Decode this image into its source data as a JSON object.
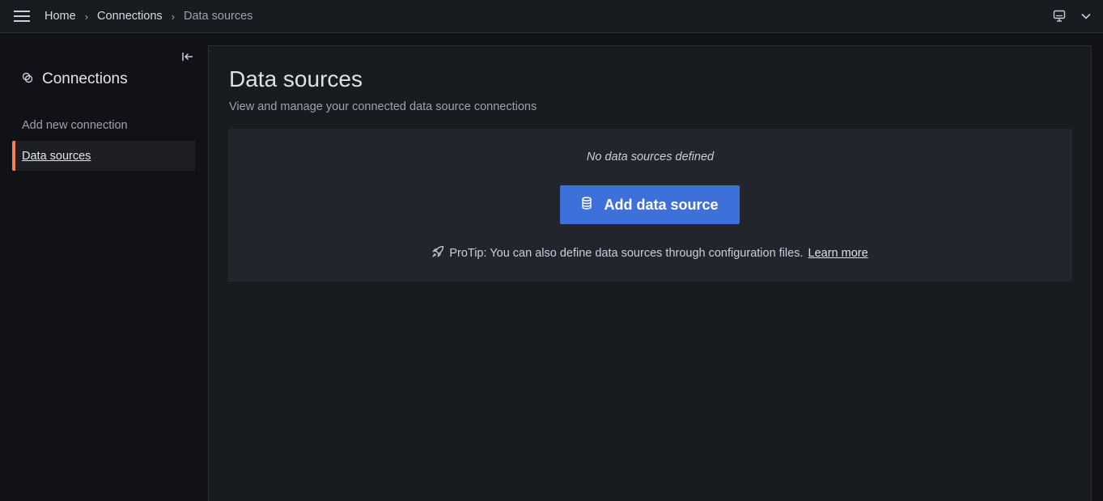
{
  "topbar": {
    "breadcrumbs": [
      "Home",
      "Connections",
      "Data sources"
    ],
    "separator": "›",
    "icons": [
      "menu-icon",
      "monitor-icon",
      "chevron-down-icon"
    ]
  },
  "sidebar": {
    "title": "Connections",
    "title_icon": "connections-icon",
    "collapse_icon": "collapse-left-icon",
    "items": [
      {
        "label": "Add new connection",
        "active": false
      },
      {
        "label": "Data sources",
        "active": true
      }
    ]
  },
  "main": {
    "title": "Data sources",
    "subtitle": "View and manage your connected data source connections",
    "empty_state": {
      "message": "No data sources defined",
      "button_label": "Add data source",
      "button_icon": "database-icon",
      "protip_icon": "rocket-icon",
      "protip_text": "ProTip: You can also define data sources through configuration files.",
      "protip_link": "Learn more"
    }
  },
  "colors": {
    "accent_active": "#f57f4c",
    "primary_button": "#3d71d9",
    "background": "#111217",
    "panel": "#181b1f"
  }
}
